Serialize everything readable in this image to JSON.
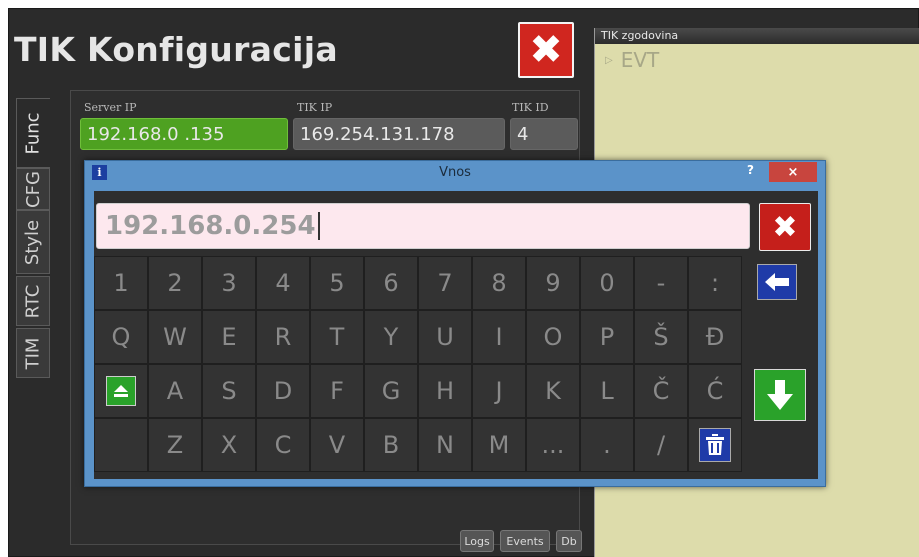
{
  "app": {
    "title": "TIK Konfiguracija"
  },
  "side_tabs": [
    "Func",
    "CFG",
    "Style",
    "RTC",
    "TIM"
  ],
  "fields": {
    "server_ip_label": "Server IP",
    "server_ip_value": "192.168.0 .135",
    "tik_ip_label": "TIK IP",
    "tik_ip_value": "169.254.131.178",
    "tik_id_label": "TIK ID",
    "tik_id_value": "4"
  },
  "bottom_buttons": {
    "logs": "Logs",
    "events": "Events",
    "db": "Db"
  },
  "history": {
    "header": "TIK zgodovina",
    "item": "EVT"
  },
  "dialog": {
    "info_icon": "i",
    "title": "Vnos",
    "help": "?",
    "close": "×",
    "input_value": "192.168.0.254"
  },
  "keyboard": {
    "row1": [
      "1",
      "2",
      "3",
      "4",
      "5",
      "6",
      "7",
      "8",
      "9",
      "0",
      "-",
      ":"
    ],
    "row2": [
      "Q",
      "W",
      "E",
      "R",
      "T",
      "Y",
      "U",
      "I",
      "O",
      "P",
      "Š",
      "Đ"
    ],
    "row3": [
      "A",
      "S",
      "D",
      "F",
      "G",
      "H",
      "J",
      "K",
      "L",
      "Č",
      "Ć"
    ],
    "row4": [
      "Z",
      "X",
      "C",
      "V",
      "B",
      "N",
      "M",
      "...",
      ".",
      "/"
    ]
  },
  "colors": {
    "close_red": "#d0261f",
    "server_ip_green": "#4ea121",
    "history_bg": "#dddcab",
    "dialog_blue": "#5b93c9",
    "backspace_blue": "#1f3ba8",
    "enter_green": "#2aa22a"
  },
  "icons": {
    "main_close": "close-icon",
    "clear_input": "close-icon",
    "backspace": "arrow-left-icon",
    "enter": "arrow-down-icon",
    "shift": "eject-icon",
    "delete": "trash-icon",
    "history_item": "triangle-right-icon"
  }
}
